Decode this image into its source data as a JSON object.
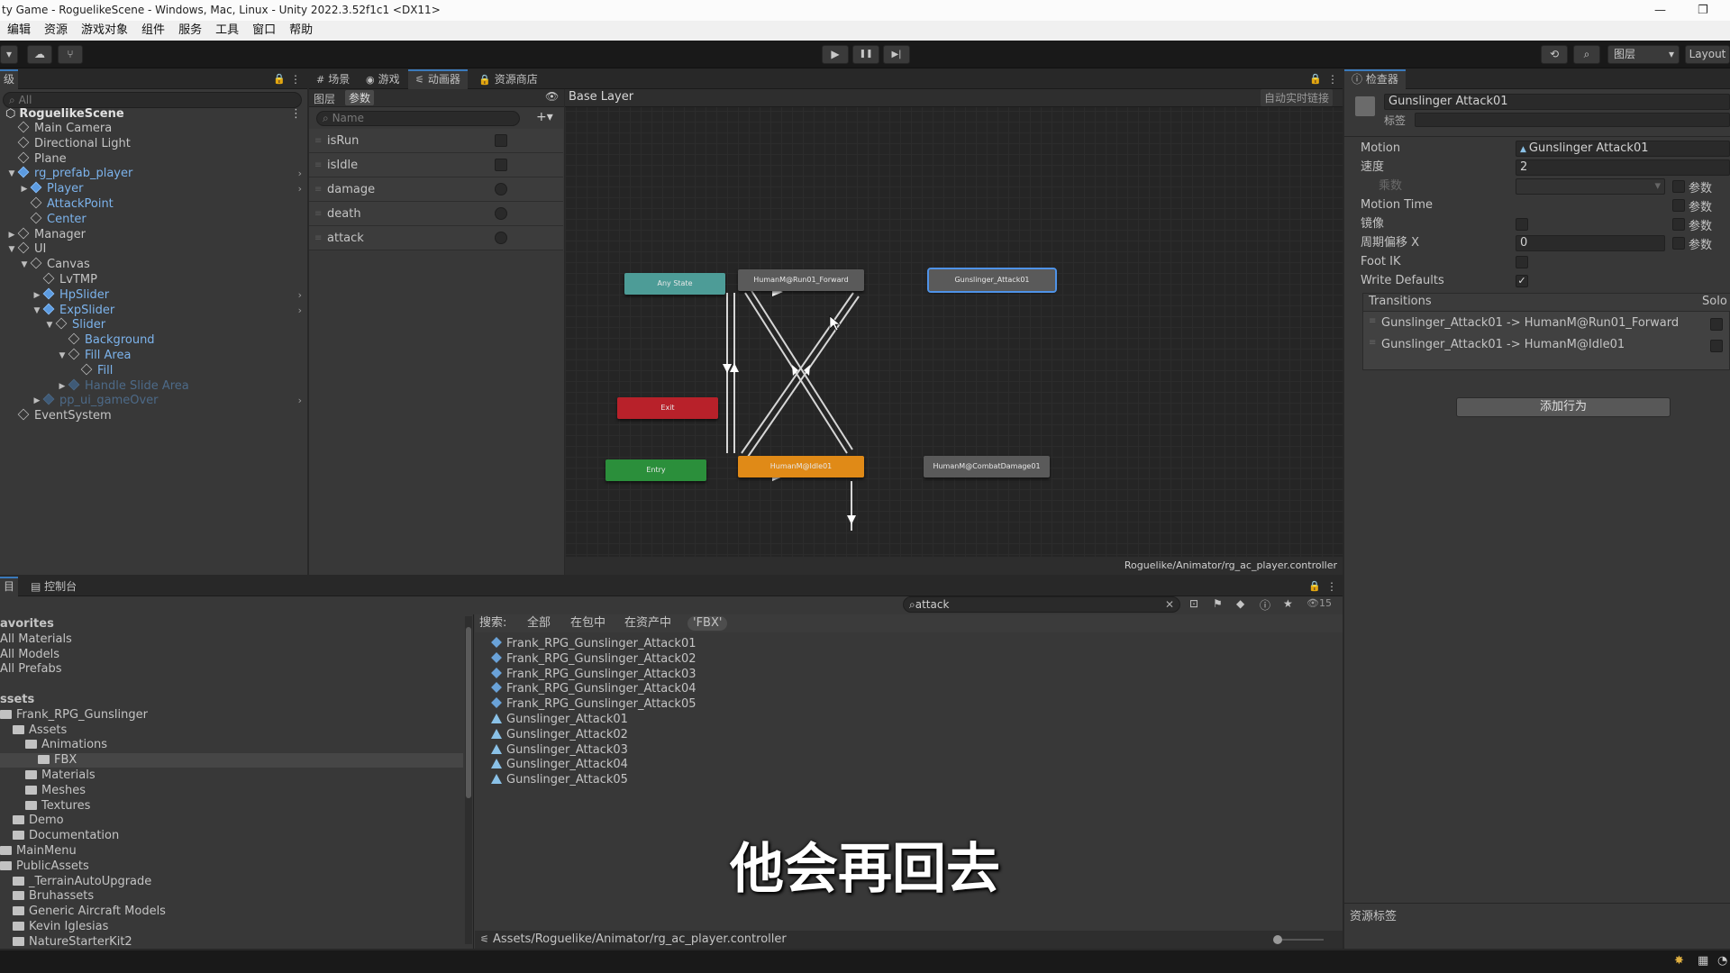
{
  "window": {
    "title": "ty Game - RoguelikeScene - Windows, Mac, Linux - Unity 2022.3.52f1c1 <DX11>",
    "minimize": "—",
    "maximize": "❐"
  },
  "menu": [
    "编辑",
    "资源",
    "游戏对象",
    "组件",
    "服务",
    "工具",
    "窗口",
    "帮助"
  ],
  "toolbar": {
    "play": "▶",
    "pause": "❚❚",
    "step": "▶|",
    "layers": "图层",
    "layout": "Layout"
  },
  "hierarchy": {
    "tab": "级",
    "search_placeholder": "All",
    "scene": "RoguelikeScene",
    "items": [
      {
        "label": "Main Camera",
        "indent": 1,
        "type": "object"
      },
      {
        "label": "Directional Light",
        "indent": 1,
        "type": "object"
      },
      {
        "label": "Plane",
        "indent": 1,
        "type": "object"
      },
      {
        "label": "rg_prefab_player",
        "indent": 1,
        "type": "prefab",
        "arrow": "▼",
        "expand": true
      },
      {
        "label": "Player",
        "indent": 2,
        "type": "prefab",
        "arrow": "▶",
        "expand": true
      },
      {
        "label": "AttackPoint",
        "indent": 2,
        "type": "prefab-child"
      },
      {
        "label": "Center",
        "indent": 2,
        "type": "prefab-child"
      },
      {
        "label": "Manager",
        "indent": 1,
        "type": "object",
        "arrow": "▶"
      },
      {
        "label": "UI",
        "indent": 1,
        "type": "object",
        "arrow": "▼"
      },
      {
        "label": "Canvas",
        "indent": 2,
        "type": "object",
        "arrow": "▼"
      },
      {
        "label": "LvTMP",
        "indent": 3,
        "type": "object"
      },
      {
        "label": "HpSlider",
        "indent": 3,
        "type": "prefab",
        "arrow": "▶",
        "expand": true
      },
      {
        "label": "ExpSlider",
        "indent": 3,
        "type": "prefab",
        "arrow": "▼",
        "expand": true
      },
      {
        "label": "Slider",
        "indent": 4,
        "type": "prefab-child",
        "arrow": "▼"
      },
      {
        "label": "Background",
        "indent": 5,
        "type": "prefab-child"
      },
      {
        "label": "Fill Area",
        "indent": 5,
        "type": "prefab-child",
        "arrow": "▼"
      },
      {
        "label": "Fill",
        "indent": 6,
        "type": "prefab-child"
      },
      {
        "label": "Handle Slide Area",
        "indent": 5,
        "type": "faded",
        "arrow": "▶"
      },
      {
        "label": "pp_ui_gameOver",
        "indent": 3,
        "type": "faded",
        "arrow": "▶",
        "expand": true
      },
      {
        "label": "EventSystem",
        "indent": 1,
        "type": "object"
      }
    ]
  },
  "center_tabs": [
    {
      "label": "场景",
      "icon": "#"
    },
    {
      "label": "游戏",
      "icon": "◉"
    },
    {
      "label": "动画器",
      "icon": "⚟",
      "active": true
    },
    {
      "label": "资源商店",
      "icon": "🔒"
    }
  ],
  "animator": {
    "subtab_layers": "图层",
    "subtab_params": "参数",
    "param_search_placeholder": "Name",
    "add": "+▾",
    "params": [
      {
        "name": "isRun",
        "kind": "bool"
      },
      {
        "name": "isIdle",
        "kind": "bool"
      },
      {
        "name": "damage",
        "kind": "trigger"
      },
      {
        "name": "death",
        "kind": "trigger"
      },
      {
        "name": "attack",
        "kind": "trigger"
      }
    ],
    "breadcrumb": "Base Layer",
    "autolive": "自动实时链接",
    "states": {
      "any": "Any State",
      "run": "HumanM@Run01_Forward",
      "attack": "Gunslinger_Attack01",
      "exit": "Exit",
      "entry": "Entry",
      "idle": "HumanM@Idle01",
      "damage": "HumanM@CombatDamage01"
    },
    "path": "Roguelike/Animator/rg_ac_player.controller"
  },
  "inspector": {
    "tab": "检查器",
    "object_name": "Gunslinger Attack01",
    "tag_label": "标签",
    "motion_label": "Motion",
    "motion_value": "Gunslinger Attack01",
    "speed_label": "速度",
    "speed_value": "2",
    "multiplier_label": "乘数",
    "param_label": "参数",
    "motion_time_label": "Motion Time",
    "mirror_label": "镜像",
    "cycle_offset_label": "周期偏移 X",
    "cycle_offset_value": "0",
    "foot_ik_label": "Foot IK",
    "write_defaults_label": "Write Defaults",
    "write_defaults_check": "✓",
    "transitions_label": "Transitions",
    "solo_label": "Solo",
    "transitions": [
      "Gunslinger_Attack01 -> HumanM@Run01_Forward",
      "Gunslinger_Attack01 -> HumanM@Idle01"
    ],
    "add_behaviour": "添加行为",
    "asset_labels": "资源标签"
  },
  "bottom_tabs": {
    "project": "目",
    "console": "控制台"
  },
  "project": {
    "search_value": "attack",
    "count": "15",
    "filter_label": "搜索:",
    "filters": [
      "全部",
      "在包中",
      "在资产中",
      "'FBX'"
    ],
    "tree": [
      {
        "label": "avorites",
        "bold": true,
        "indent": 0
      },
      {
        "label": "All Materials",
        "indent": 0
      },
      {
        "label": "All Models",
        "indent": 0
      },
      {
        "label": "All Prefabs",
        "indent": 0
      },
      {
        "label": "",
        "indent": 0
      },
      {
        "label": "ssets",
        "bold": true,
        "indent": 0
      },
      {
        "label": "Frank_RPG_Gunslinger",
        "indent": 0,
        "folder": true
      },
      {
        "label": "Assets",
        "indent": 1,
        "folder": true
      },
      {
        "label": "Animations",
        "indent": 2,
        "folder": true
      },
      {
        "label": "FBX",
        "indent": 3,
        "folder": true,
        "selected": true
      },
      {
        "label": "Materials",
        "indent": 2,
        "folder": true
      },
      {
        "label": "Meshes",
        "indent": 2,
        "folder": true
      },
      {
        "label": "Textures",
        "indent": 2,
        "folder": true
      },
      {
        "label": "Demo",
        "indent": 1,
        "folder": true
      },
      {
        "label": "Documentation",
        "indent": 1,
        "folder": true
      },
      {
        "label": "MainMenu",
        "indent": 0,
        "folder": true
      },
      {
        "label": "PublicAssets",
        "indent": 0,
        "folder": true
      },
      {
        "label": "_TerrainAutoUpgrade",
        "indent": 1,
        "folder": true
      },
      {
        "label": "Bruhassets",
        "indent": 1,
        "folder": true
      },
      {
        "label": "Generic Aircraft Models",
        "indent": 1,
        "folder": true
      },
      {
        "label": "Kevin Iglesias",
        "indent": 1,
        "folder": true
      },
      {
        "label": "NatureStarterKit2",
        "indent": 1,
        "folder": true
      },
      {
        "label": "Outpost",
        "indent": 1,
        "folder": true
      }
    ],
    "results": [
      {
        "label": "Frank_RPG_Gunslinger_Attack01",
        "kind": "fbx"
      },
      {
        "label": "Frank_RPG_Gunslinger_Attack02",
        "kind": "fbx"
      },
      {
        "label": "Frank_RPG_Gunslinger_Attack03",
        "kind": "fbx"
      },
      {
        "label": "Frank_RPG_Gunslinger_Attack04",
        "kind": "fbx"
      },
      {
        "label": "Frank_RPG_Gunslinger_Attack05",
        "kind": "fbx"
      },
      {
        "label": "Gunslinger_Attack01",
        "kind": "anim"
      },
      {
        "label": "Gunslinger_Attack02",
        "kind": "anim"
      },
      {
        "label": "Gunslinger_Attack03",
        "kind": "anim"
      },
      {
        "label": "Gunslinger_Attack04",
        "kind": "anim"
      },
      {
        "label": "Gunslinger_Attack05",
        "kind": "anim"
      }
    ],
    "footer_path": "Assets/Roguelike/Animator/rg_ac_player.controller"
  },
  "subtitle": "他会再回去",
  "colors": {
    "any_state": "#4d9c97",
    "exit": "#b8212a",
    "entry": "#2b8f3b",
    "default_state": "#e08a17",
    "state": "#5a5a5a",
    "selected_border": "#4f93e8",
    "accent": "#3a79bb"
  }
}
